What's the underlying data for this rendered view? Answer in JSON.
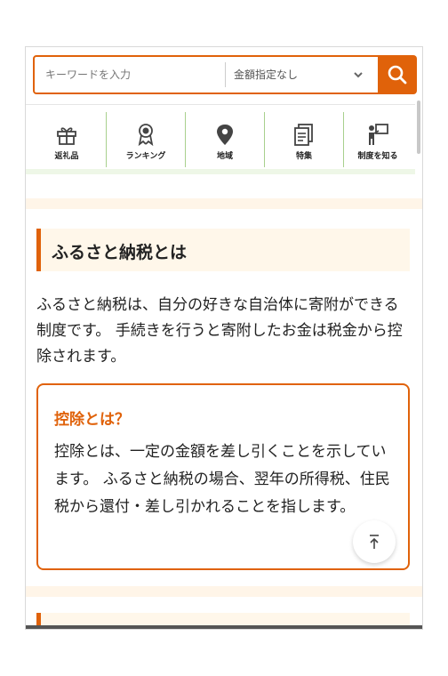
{
  "search": {
    "keyword_placeholder": "キーワードを入力",
    "amount_selected": "金額指定なし"
  },
  "nav": {
    "items": [
      {
        "label": "返礼品",
        "icon": "gift-icon"
      },
      {
        "label": "ランキング",
        "icon": "ribbon-medal-icon"
      },
      {
        "label": "地域",
        "icon": "map-pin-icon"
      },
      {
        "label": "特集",
        "icon": "document-icon"
      },
      {
        "label": "制度を知る",
        "icon": "teacher-board-icon"
      }
    ]
  },
  "main": {
    "heading": "ふるさと納税とは",
    "paragraph": "ふるさと納税は、自分の好きな自治体に寄附ができる制度です。 手続きを行うと寄附したお金は税金から控除されます。",
    "card": {
      "title": "控除とは？",
      "body": "控除とは、一定の金額を差し引くことを示しています。 ふるさと納税の場合、翌年の所得税、住民税から還付・差し引かれることを指します。"
    }
  },
  "colors": {
    "accent": "#e0620a",
    "heading_bg": "#fff7ea",
    "nav_divider": "#a8d08d"
  }
}
